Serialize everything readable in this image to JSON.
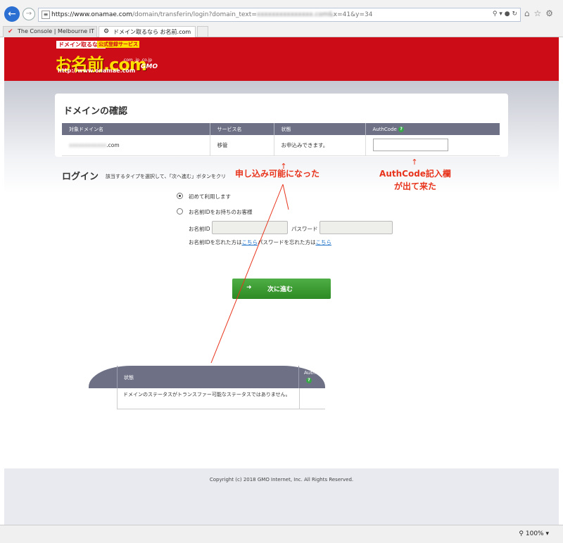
{
  "browser": {
    "url_main": "https://www.onamae.com",
    "url_path": "/domain/transferin/login?domain_text=",
    "url_tail": "x=41&y=34",
    "tabs": [
      {
        "label": "The Console | Melbourne IT",
        "active": false
      },
      {
        "label": "ドメイン取るなら お名前.com",
        "active": true
      }
    ],
    "zoom": "100%"
  },
  "header": {
    "logo_tag": "ドメイン取るなら",
    "logo_badge": "公式登録サービス",
    "logo_main": "お名前.com",
    "logo_tlds": ".com  .jp  .co.jp",
    "logo_url": "http://www.onamae.com",
    "logo_gmo": "GMO"
  },
  "domain_confirm": {
    "title": "ドメインの確認",
    "columns": [
      "対象ドメイン名",
      "サービス名",
      "状態",
      "AuthCode"
    ],
    "row": {
      "domain": ".com",
      "service": "移管",
      "status": "お申込みできます。"
    }
  },
  "login": {
    "title": "ログイン",
    "description": "該当するタイプを選択して、「次へ進む」ボタンをクリ",
    "option_first": "初めて利用します",
    "option_existing": "お名前IDをお持ちのお客様",
    "id_label": "お名前ID",
    "password_label": "パスワード",
    "forgot_id_prefix": "お名前IDを忘れた方は",
    "forgot_id_link": "こちら",
    "forgot_pw_prefix": "パスワードを忘れた方は",
    "forgot_pw_link": "こちら",
    "next_button": "次に進む"
  },
  "inset": {
    "col_status": "状態",
    "col_auth": "Auth",
    "cell_text": "ドメインのステータスがトランスファー可能なステータスではありません。"
  },
  "annotations": {
    "left": "申し込み可能になった",
    "right_line1": "AuthCode記入欄",
    "right_line2": "が出て来た",
    "color": "#e8341c"
  },
  "footer": {
    "copyright": "Copyright (c) 2018 GMO Internet, Inc. All Rights Reserved."
  }
}
